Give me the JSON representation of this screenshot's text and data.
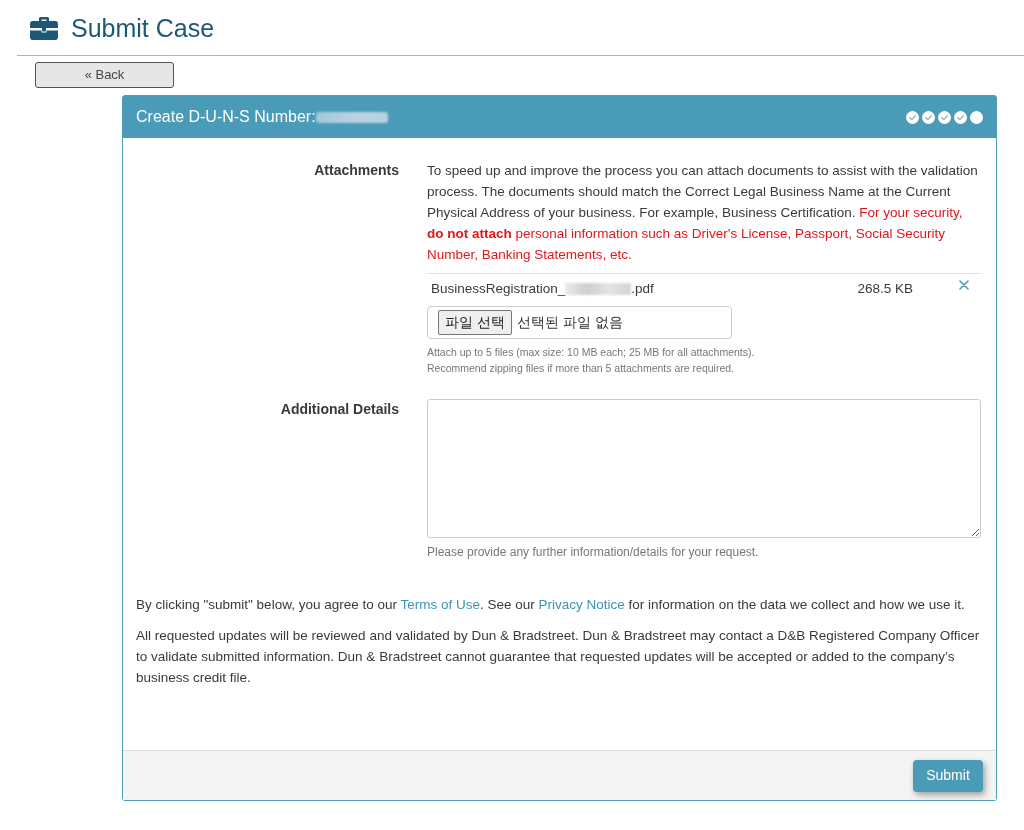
{
  "header": {
    "title": "Submit Case"
  },
  "back_button": "« Back",
  "card": {
    "title": "Create D-U-N-S Number:",
    "steps": [
      {
        "done": true
      },
      {
        "done": true
      },
      {
        "done": true
      },
      {
        "done": true
      },
      {
        "done": false
      }
    ]
  },
  "attachments": {
    "label": "Attachments",
    "description": "To speed up and improve the process you can attach documents to assist with the validation process. The documents should match the Correct Legal Business Name at the Current Physical Address of your business. For example, Business Certification.",
    "warning": "For your security, **do not attach** personal information such as Driver's License, Passport, Social Security Number, Banking Statements, etc.",
    "files": [
      {
        "name_start": "BusinessRegistration_",
        "name_end": ".pdf",
        "size": "268.5 KB"
      }
    ],
    "file_input": {
      "button": "파일 선택",
      "status": "선택된 파일 없음"
    },
    "help": [
      "Attach up to 5 files (max size: 10 MB each; 25 MB for all attachments).",
      "Recommend zipping files if more than 5 attachments are required."
    ]
  },
  "additional_details": {
    "label": "Additional Details",
    "help": "Please provide any further information/details for your request."
  },
  "notices": [
    {
      "parts": [
        {
          "kind": "text",
          "text": "By clicking \"submit\" below, you agree to our "
        },
        {
          "kind": "link",
          "text": "Terms of Use"
        },
        {
          "kind": "text",
          "text": ". See our "
        },
        {
          "kind": "link",
          "text": "Privacy Notice"
        },
        {
          "kind": "text",
          "text": " for information on the data we collect and how we use it."
        }
      ]
    },
    {
      "parts": [
        {
          "kind": "text",
          "text": "All requested updates will be reviewed and validated by Dun & Bradstreet. Dun & Bradstreet may contact a D&B Registered Company Officer to validate submitted information. Dun & Bradstreet cannot guarantee that requested updates will be accepted or added to the company’s business credit file."
        }
      ]
    }
  ],
  "submit_button": "Submit"
}
